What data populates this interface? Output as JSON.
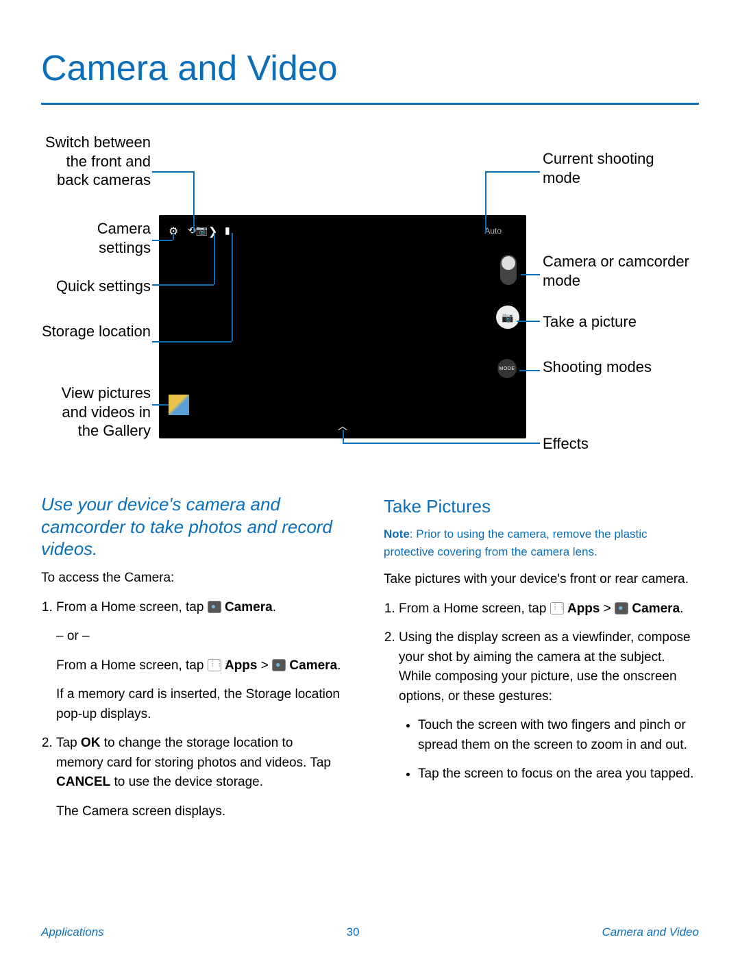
{
  "title": "Camera and Video",
  "callouts": {
    "switch_camera": "Switch between the front and back cameras",
    "camera_settings": "Camera settings",
    "quick_settings": "Quick settings",
    "storage_location": "Storage location",
    "gallery": "View pictures and videos in the Gallery",
    "shooting_mode": "Current shooting mode",
    "cam_camcorder": "Camera or camcorder mode",
    "take_picture": "Take a picture",
    "shooting_modes": "Shooting modes",
    "effects": "Effects"
  },
  "screen": {
    "auto_label": "Auto",
    "mode_label": "MODE"
  },
  "intro": "Use your device's camera and camcorder to take photos and record videos.",
  "left": {
    "access_label": "To access the Camera:",
    "step1_prefix": "From a Home screen, tap ",
    "step1_word_camera": "Camera",
    "step1_period": ".",
    "or": "– or –",
    "step1b_prefix": "From a Home screen, tap ",
    "step1b_apps": "Apps",
    "step1b_sep": " > ",
    "step1b_camera": "Camera",
    "step1b_period": ".",
    "step1c": "If a memory card is inserted, the Storage location pop-up displays.",
    "step2_a": "Tap ",
    "step2_ok": "OK",
    "step2_b": " to change the storage location to memory card for storing photos and videos. Tap ",
    "step2_cancel": "CANCEL",
    "step2_c": " to use the device storage.",
    "step2d": "The Camera screen displays."
  },
  "right": {
    "heading": "Take Pictures",
    "note_bold": "Note",
    "note_text": ": Prior to using the camera, remove the plastic protective covering from the camera lens.",
    "lead": "Take pictures with your device's front or rear camera.",
    "s1_prefix": "From a Home screen, tap ",
    "s1_apps": "Apps",
    "s1_sep": " > ",
    "s1_camera": "Camera",
    "s1_period": ".",
    "s2": "Using the display screen as a viewfinder, compose your shot by aiming the camera at the subject. While composing your picture, use the onscreen options, or these gestures:",
    "b1": "Touch the screen with two fingers and pinch or spread them on the screen to zoom in and out.",
    "b2": "Tap the screen to focus on the area you tapped."
  },
  "footer": {
    "left": "Applications",
    "center": "30",
    "right": "Camera and Video"
  }
}
